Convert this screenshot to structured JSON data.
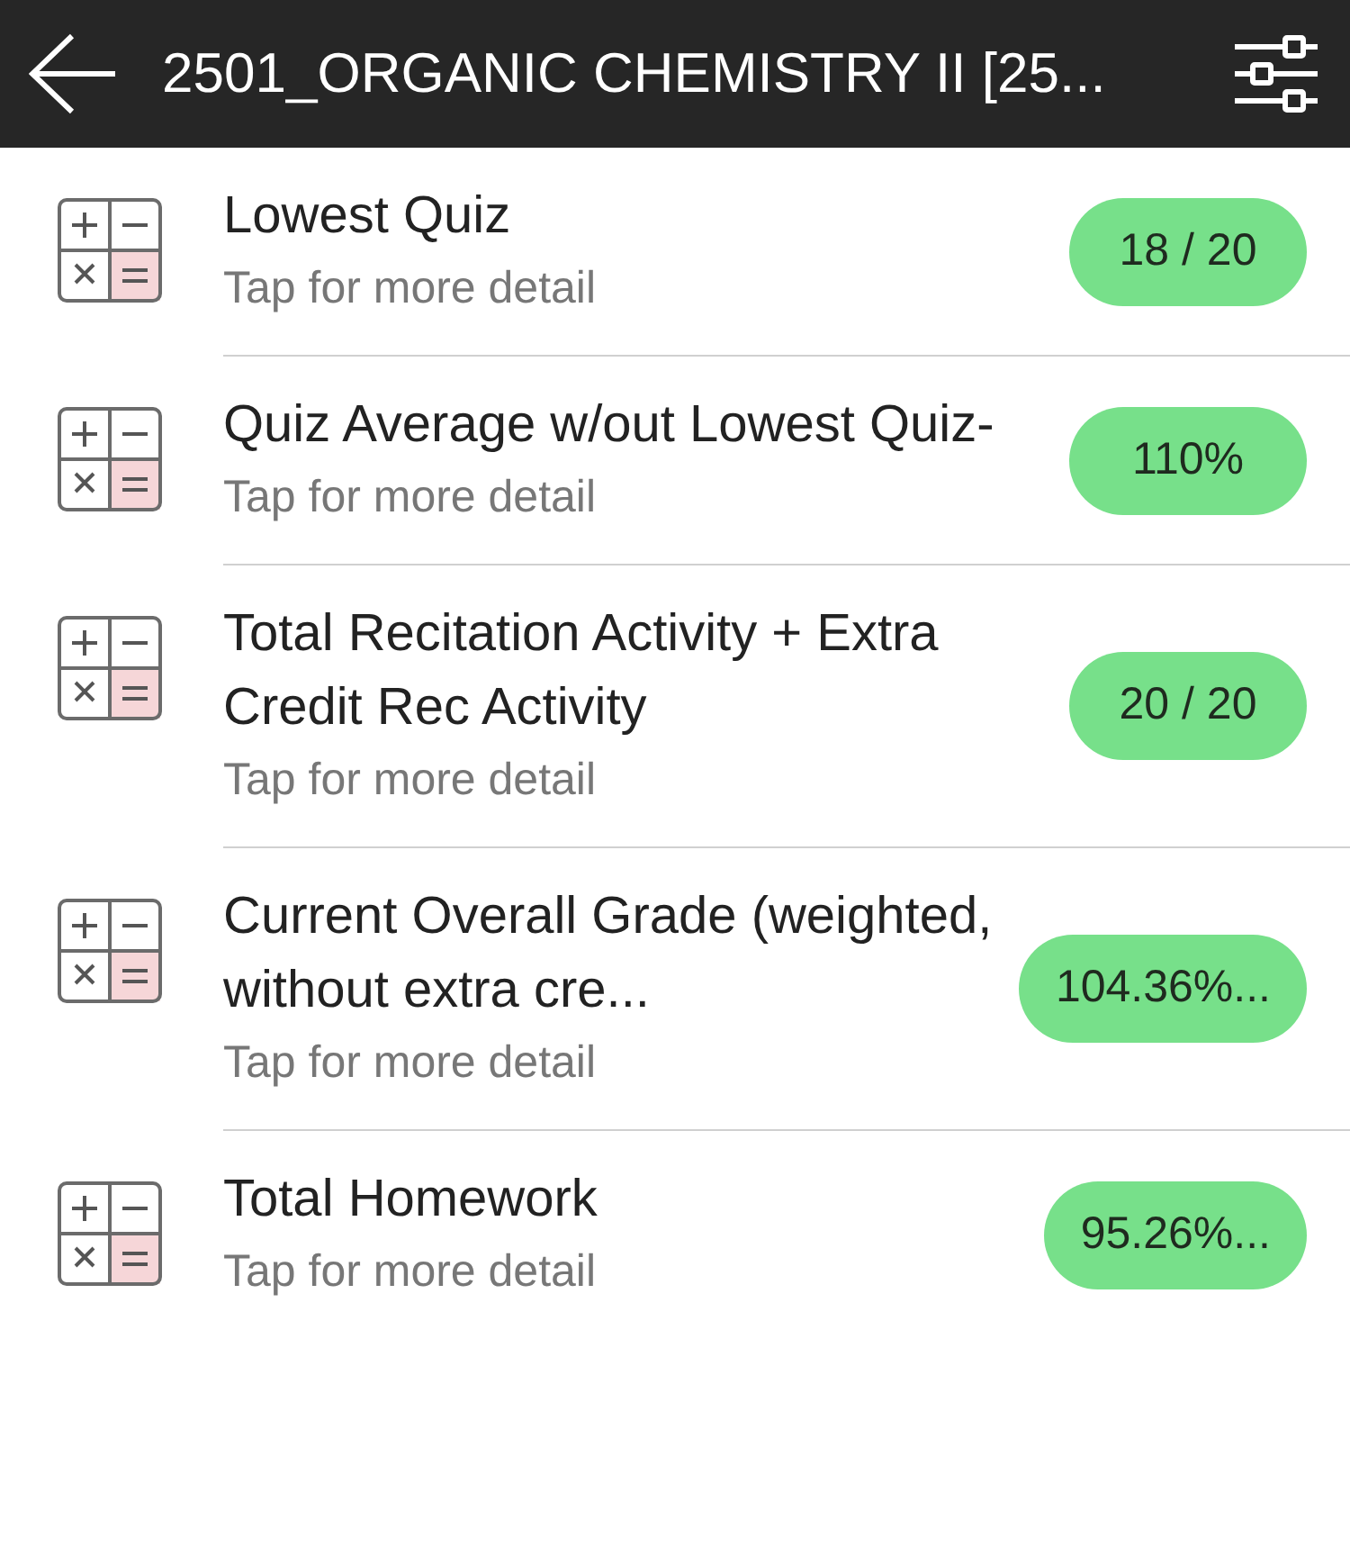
{
  "header": {
    "title": "2501_ORGANIC CHEMISTRY II [25..."
  },
  "items": [
    {
      "title": "Lowest Quiz",
      "subtitle": "Tap for more detail",
      "grade": "18 / 20"
    },
    {
      "title": "Quiz Average w/out Lowest Quiz-",
      "subtitle": "Tap for more detail",
      "grade": "110%"
    },
    {
      "title": "Total Recitation Activity + Extra Credit Rec Activity",
      "subtitle": "Tap for more detail",
      "grade": "20 / 20"
    },
    {
      "title": "Current Overall Grade (weighted, without extra cre...",
      "subtitle": "Tap for more detail",
      "grade": "104.36%..."
    },
    {
      "title": "Total Homework",
      "subtitle": "Tap for more detail",
      "grade": "95.26%..."
    }
  ]
}
